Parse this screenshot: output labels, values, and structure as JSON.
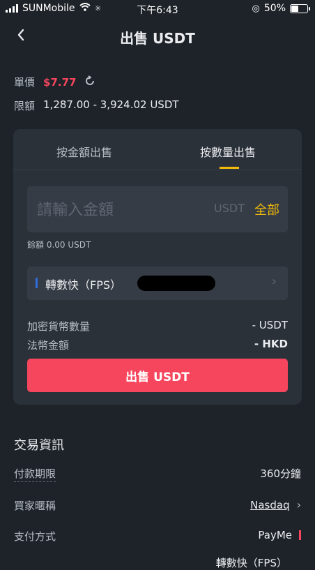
{
  "status_bar": {
    "carrier": "SUNMobile",
    "time": "下午6:43",
    "battery": "50%",
    "battery_level": 0.5
  },
  "header": {
    "title": "出售 USDT"
  },
  "price": {
    "label": "單價",
    "value": "$7.77"
  },
  "limit": {
    "label": "限額",
    "value": "1,287.00 - 3,924.02 USDT"
  },
  "tabs": [
    {
      "label": "按金額出售",
      "active": false
    },
    {
      "label": "按數量出售",
      "active": true
    }
  ],
  "amount": {
    "placeholder": "請輸入金額",
    "unit": "USDT",
    "all_label": "全部"
  },
  "balance": "餘額 0.00 USDT",
  "payment": {
    "label": "轉數快（FPS）"
  },
  "crypto_amount": {
    "label": "加密貨幣數量",
    "value": "- USDT"
  },
  "fiat_amount": {
    "label": "法幣金額",
    "value": "- HKD"
  },
  "sell_button": "出售 USDT",
  "trade_info": {
    "title": "交易資訊",
    "rows": [
      {
        "label": "付款期限",
        "value": "360分鐘"
      },
      {
        "label": "買家暱稱",
        "value": "Nasdaq"
      },
      {
        "label": "支付方式",
        "value": "PayMe"
      },
      {
        "label": "",
        "value": "轉數快（FPS）"
      }
    ]
  },
  "colors": {
    "background": "#1e2329",
    "card": "#2b3139",
    "accent_yellow": "#f0b90b",
    "sell_red": "#f6465d",
    "fps_blue": "#2f6fdb"
  }
}
